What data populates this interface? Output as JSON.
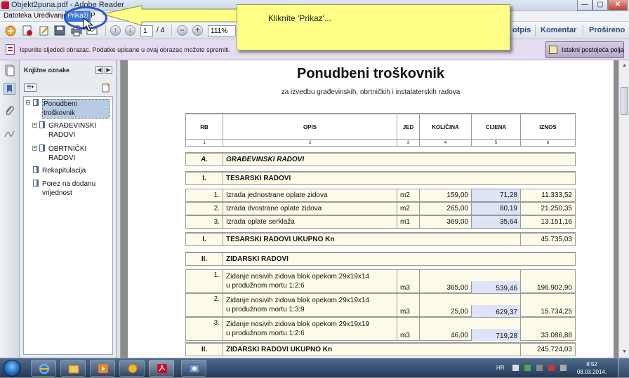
{
  "window": {
    "title": "Objekt2puna.pdf - Adobe Reader",
    "controls": {
      "minimize": "—",
      "maximize": "▢",
      "close": "✕"
    }
  },
  "menubar": {
    "items": [
      "Datoteka",
      "Uređivanje",
      "Prikaži",
      "P"
    ],
    "active_index": 2
  },
  "toolbar": {
    "page_current": "1",
    "page_total": "/ 4",
    "zoom": "111%",
    "right_links": [
      "otpis",
      "Komentar",
      "Prošireno"
    ]
  },
  "form_notice": {
    "message": "Ispunite sljedeći obrazac. Podatke upisane u ovaj obrazac možete spremiti.",
    "highlight_button": "Istakni postojeća polja"
  },
  "callout": {
    "text": "Kliknite 'Prikaz'...",
    "color": "#ffff88"
  },
  "bookmarks": {
    "title": "Knjižne oznake",
    "items": [
      {
        "label": "Ponudbeni troškovnik",
        "expandable": false,
        "selected": true,
        "indent": 1
      },
      {
        "label": "GRAĐEVINSKI RADOVI",
        "expandable": true,
        "selected": false,
        "indent": 2
      },
      {
        "label": "OBRTNIČKI RADOVI",
        "expandable": true,
        "selected": false,
        "indent": 2
      },
      {
        "label": "Rekapitulacija",
        "expandable": false,
        "selected": false,
        "indent": 1
      },
      {
        "label": "Porez na dodanu vrijednost",
        "expandable": false,
        "selected": false,
        "indent": 1
      }
    ]
  },
  "document": {
    "title": "Ponudbeni troškovnik",
    "subtitle": "za izvedbu građevinskih, obrtničkih i instalaterskih radova",
    "columns": [
      "RB",
      "OPIS",
      "JED",
      "KOLIČINA",
      "CIJENA",
      "IZNOS"
    ],
    "column_numbers": [
      "1",
      "2",
      "3",
      "4",
      "5",
      "6"
    ],
    "section": {
      "rb": "A.",
      "title": "GRAĐEVINSKI RADOVI"
    },
    "groups": [
      {
        "rb": "I.",
        "title": "TESARSKI RADOVI",
        "items": [
          {
            "rb": "1.",
            "line1": "Izrada jednostrane oplate zidova",
            "line2": "",
            "jed": "m2",
            "kolicina": "159,00",
            "cijena": "71,28",
            "iznos": "11.333,52"
          },
          {
            "rb": "2.",
            "line1": "Izrada dvostrane oplate zidova",
            "line2": "",
            "jed": "m2",
            "kolicina": "265,00",
            "cijena": "80,19",
            "iznos": "21.250,35"
          },
          {
            "rb": "3.",
            "line1": "Izrada oplate serklaža",
            "line2": "",
            "jed": "m1",
            "kolicina": "369,00",
            "cijena": "35,64",
            "iznos": "13.151,16"
          }
        ],
        "total_rb": "I.",
        "total_label": "TESARSKI RADOVI UKUPNO Kn",
        "total_value": "45.735,03"
      },
      {
        "rb": "II.",
        "title": "ZIDARSKI RADOVI",
        "items": [
          {
            "rb": "1.",
            "line1": "Zidanje nosivih zidova blok opekom 29x19x14",
            "line2": "u produžnom mortu 1:2:6",
            "jed": "m3",
            "kolicina": "365,00",
            "cijena": "539,46",
            "iznos": "196.902,90"
          },
          {
            "rb": "2.",
            "line1": "Zidanje nosivih zidova blok opekom 29x19x14",
            "line2": "u produžnom mortu 1:3:9",
            "jed": "m3",
            "kolicina": "25,00",
            "cijena": "629,37",
            "iznos": "15.734,25"
          },
          {
            "rb": "3.",
            "line1": "Zidanje nosivih zidova blok opekom 29x19x19",
            "line2": "u produžnom mortu 1:2:6",
            "jed": "m3",
            "kolicina": "46,00",
            "cijena": "719,28",
            "iznos": "33.086,88"
          }
        ],
        "total_rb": "II.",
        "total_label": "ZIDARSKI RADOVI UKUPNO Kn",
        "total_value": "245.724,03"
      }
    ]
  },
  "taskbar": {
    "language": "HR",
    "time": "8:52",
    "date": "08.03.2014."
  },
  "colors": {
    "menu_active": "#3a78d4",
    "form_bar": "#e6dcf0",
    "price_fill": "#dde4f8",
    "ellipse": "#2d4fd8"
  }
}
